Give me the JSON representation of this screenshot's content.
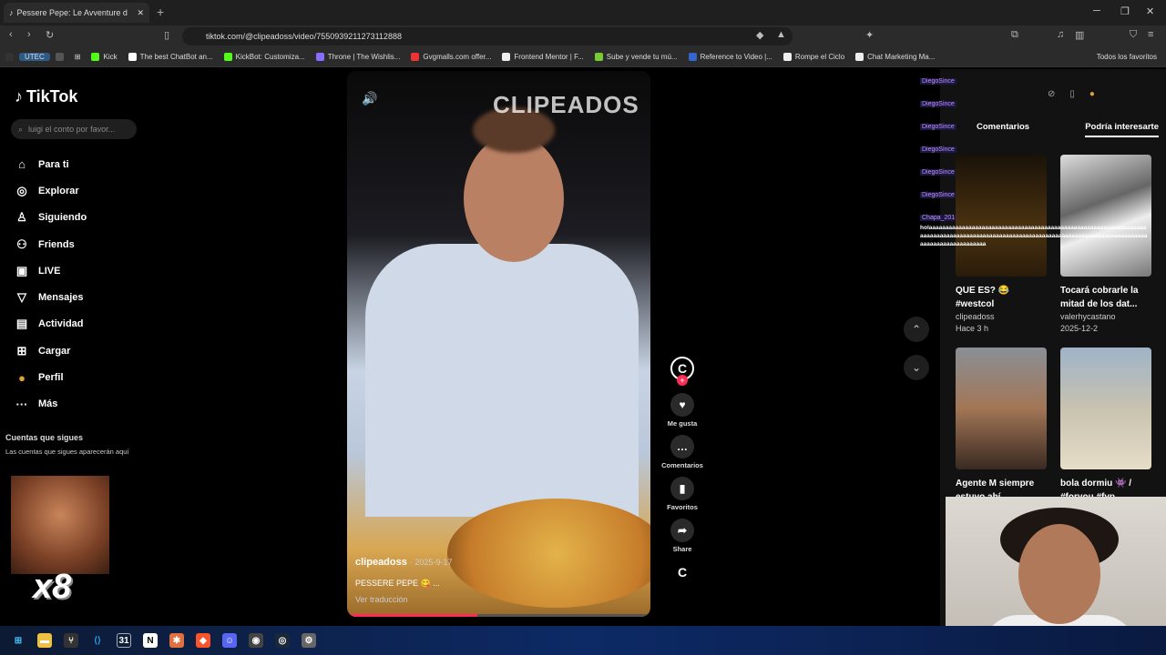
{
  "browser": {
    "tab_title": "Pessere Pepe: Le Avventure d",
    "url": "tiktok.com/@clipeadoss/video/7550939211273112888",
    "bookmarks": [
      {
        "label": "UTEC",
        "color": "#3c6"
      },
      {
        "label": "",
        "color": "#777"
      },
      {
        "label": "",
        "color": "#777"
      },
      {
        "label": "Kick",
        "color": "#53fc18"
      },
      {
        "label": "The best ChatBot an...",
        "color": "#fff"
      },
      {
        "label": "KickBot: Customiza...",
        "color": "#53fc18"
      },
      {
        "label": "Throne | The Wishlis...",
        "color": "#8a6cff"
      },
      {
        "label": "Gvgmalls.com offer...",
        "color": "#e33"
      },
      {
        "label": "Frontend Mentor | F...",
        "color": "#eee"
      },
      {
        "label": "Sube y vende tu mú...",
        "color": "#7c3"
      },
      {
        "label": "Reference to Video |...",
        "color": "#36c"
      },
      {
        "label": "Rompe el Ciclo",
        "color": "#eee"
      },
      {
        "label": "Chat Marketing Ma...",
        "color": "#eee"
      }
    ],
    "bookmarks_right": "Todos los favoritos"
  },
  "tiktok": {
    "logo": "TikTok",
    "search_placeholder": "luigi el conto por favor...",
    "nav": [
      {
        "label": "Para ti",
        "icon": "home-icon",
        "glyph": "⌂"
      },
      {
        "label": "Explorar",
        "icon": "compass-icon",
        "glyph": "◎"
      },
      {
        "label": "Siguiendo",
        "icon": "following-icon",
        "glyph": "♙"
      },
      {
        "label": "Friends",
        "icon": "friends-icon",
        "glyph": "⚇"
      },
      {
        "label": "LIVE",
        "icon": "live-icon",
        "glyph": "▣"
      },
      {
        "label": "Mensajes",
        "icon": "messages-icon",
        "glyph": "▽"
      },
      {
        "label": "Actividad",
        "icon": "activity-icon",
        "glyph": "▤"
      },
      {
        "label": "Cargar",
        "icon": "upload-icon",
        "glyph": "⊞"
      },
      {
        "label": "Perfil",
        "icon": "profile-icon",
        "glyph": "●"
      },
      {
        "label": "Más",
        "icon": "more-icon",
        "glyph": "···"
      }
    ],
    "following_title": "Cuentas que sigues",
    "following_sub": "Las cuentas que sigues aparecerán aquí",
    "meme_text": "x8"
  },
  "video": {
    "watermark": "CLIPEADOS",
    "author": "clipeadoss",
    "date": "· 2025-9-17",
    "caption": "PESSERE PEPE 😋 ...",
    "translate": "Ver traducción",
    "progress": 0.43
  },
  "actions": {
    "like": "Me gusta",
    "comments": "Comentarios",
    "favorites": "Favoritos",
    "share": "Share"
  },
  "right_panel": {
    "tab_comments": "Comentarios",
    "tab_interest": "Podría interesarte",
    "chat_users": [
      "DiegoSince",
      "DiegoSince",
      "DiegoSince",
      "DiegoSince",
      "DiegoSince",
      "DiegoSince",
      "Chapa_201"
    ],
    "chat_spam": "holaaaaaaaaaaaaaaaaaaaaaaaaaaaaaaaaaaaaaaaaaaaaaaaaaaaaaaaaaaaaaaaaaaaaaaaaaaaaaaaaaaaaaaaaaaaaaaaaaaaaaaaaaaaaaaaaaaaaaaaaaaaaaaaaaaaaaaaaaaaaaaaaaaaaaaaaaaa",
    "cards": [
      {
        "title": "QUE ES? 😂 #westcol",
        "author": "clipeadoss",
        "time": "Hace 3 h"
      },
      {
        "title": "Tocará cobrarle la mitad de los dat...",
        "author": "valerhycastano",
        "time": "2025-12-2"
      },
      {
        "title": "Agente M siempre estuvo ahí",
        "author": "",
        "time": ""
      },
      {
        "title": "bola dormiu 👾 / #foryou #fyp",
        "author": "",
        "time": ""
      }
    ]
  }
}
